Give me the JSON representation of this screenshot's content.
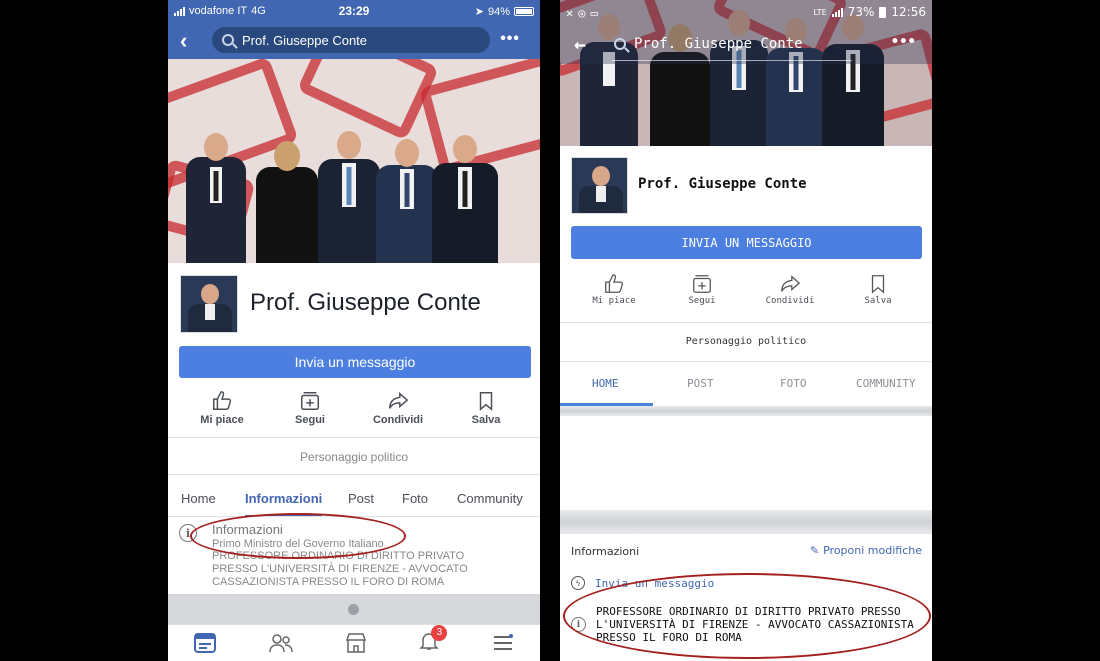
{
  "left": {
    "status": {
      "carrier": "vodafone IT",
      "network": "4G",
      "time": "23:29",
      "battery": "94%"
    },
    "search": {
      "query": "Prof. Giuseppe Conte"
    },
    "page": {
      "name": "Prof. Giuseppe Conte",
      "message_button": "Invia un messaggio",
      "actions": [
        "Mi piace",
        "Segui",
        "Condividi",
        "Salva"
      ],
      "category": "Personaggio politico",
      "tabs": [
        "Home",
        "Informazioni",
        "Post",
        "Foto",
        "Community"
      ],
      "active_tab": "Informazioni"
    },
    "info": {
      "title": "Informazioni",
      "subtitle": "Primo Ministro del Governo Italiano",
      "body": "PROFESSORE ORDINARIO DI DIRITTO PRIVATO PRESSO L'UNIVERSITÀ DI FIRENZE - AVVOCATO CASSAZIONISTA PRESSO IL FORO DI ROMA"
    },
    "tabbar": {
      "icons": [
        "news-feed-icon",
        "friends-icon",
        "marketplace-icon",
        "notifications-icon",
        "menu-icon"
      ],
      "notification_count": "3"
    }
  },
  "right": {
    "status": {
      "network": "LTE",
      "battery": "73%",
      "time": "12:56"
    },
    "search": {
      "query": "Prof. Giuseppe Conte"
    },
    "page": {
      "name": "Prof. Giuseppe Conte",
      "message_button": "INVIA UN MESSAGGIO",
      "actions": [
        "Mi piace",
        "Segui",
        "Condividi",
        "Salva"
      ],
      "category": "Personaggio politico",
      "tabs": [
        "HOME",
        "POST",
        "FOTO",
        "COMMUNITY"
      ],
      "active_tab": "HOME"
    },
    "info": {
      "title": "Informazioni",
      "propose_edit": "Proponi modifiche",
      "send_message": "Invia un messaggio",
      "body": "PROFESSORE ORDINARIO DI DIRITTO PRIVATO PRESSO L'UNIVERSITÀ DI FIRENZE - AVVOCATO CASSAZIONISTA PRESSO IL FORO DI ROMA"
    }
  },
  "colors": {
    "facebook_blue": "#4267b2",
    "button_blue": "#4c7fdf",
    "annotation_red": "#a3211f"
  }
}
